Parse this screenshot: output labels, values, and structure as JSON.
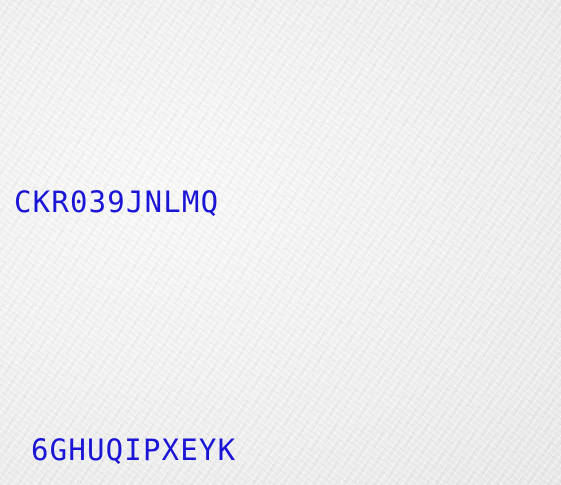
{
  "texts": [
    {
      "value": "CKR039JNLMQ",
      "color": "#1a14d6"
    },
    {
      "value": "6GHUQIPXEYK",
      "color": "#1a14d6"
    }
  ]
}
